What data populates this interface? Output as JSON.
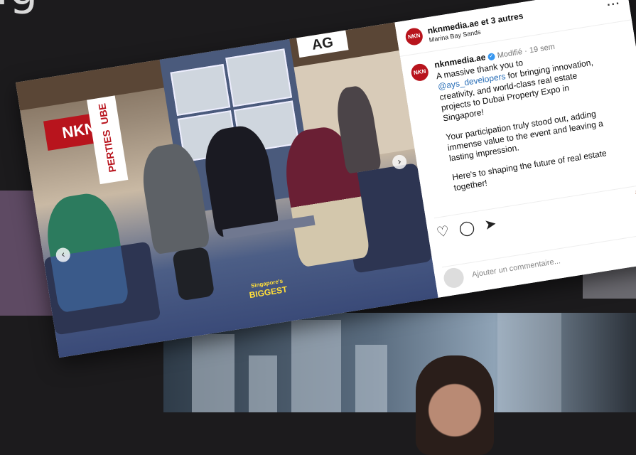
{
  "background": {
    "heading": "ig"
  },
  "post": {
    "header": {
      "account": "nknmedia.ae et 3 autres",
      "location": "Marina Bay Sands",
      "avatar_text": "NKN"
    },
    "photo": {
      "sign_left": "NKN",
      "sign_brand": "UBE",
      "sign_brand_2": "PERTIES",
      "top_sign": "AG",
      "event_logo_line1": "Singapore's",
      "event_logo_line2": "BIGGEST"
    },
    "caption": {
      "username": "nknmedia.ae",
      "verified_glyph": "✓",
      "edited": "Modifié",
      "separator": "·",
      "time": "19 sem",
      "intro": "A massive thank you to",
      "mention": "@ays_developers",
      "rest": " for bringing innovation, creativity, and world-class real estate projects to Dubai Property Expo in Singapore!",
      "paragraph2": "Your participation truly stood out, adding immense value to the event and leaving a lasting impression.",
      "paragraph3": "Here's to shaping the future of real estate together!"
    },
    "actions": {
      "like_icon": "♡",
      "comment_icon": "◯",
      "share_icon": "➤",
      "save_icon": "🔖"
    },
    "comment": {
      "placeholder": "Ajouter un commentaire...",
      "emoji_icon": "☺"
    },
    "nav": {
      "prev": "‹",
      "next": "›"
    }
  }
}
